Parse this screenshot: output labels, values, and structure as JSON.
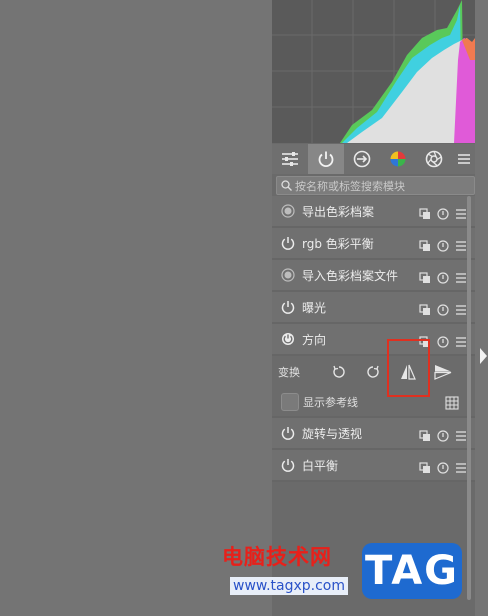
{
  "tabs": [
    {
      "icon": "sliders-icon"
    },
    {
      "icon": "power-icon",
      "active": true
    },
    {
      "icon": "signal-arrow-icon"
    },
    {
      "icon": "color-circle-icon"
    },
    {
      "icon": "aperture-icon"
    },
    {
      "icon": "menu-icon"
    }
  ],
  "search": {
    "placeholder": "按名称或标签搜索模块"
  },
  "modules": [
    {
      "name": "导出色彩档案",
      "power_style": "radio"
    },
    {
      "name": "rgb 色彩平衡",
      "power_style": "power"
    },
    {
      "name": "导入色彩档案文件",
      "power_style": "radio"
    },
    {
      "name": "曝光",
      "power_style": "power"
    },
    {
      "name": "方向",
      "power_style": "power"
    }
  ],
  "orientation": {
    "transform_label": "变换",
    "show_guides_label": "显示参考线"
  },
  "modules_after": [
    {
      "name": "旋转与透视"
    },
    {
      "name": "白平衡"
    }
  ],
  "watermark": {
    "site_name": "电脑技术网",
    "url": "www.tagxp.com",
    "badge": "TAG"
  },
  "colors": {
    "highlight": "#e03020",
    "panel": "#6a6a6a",
    "canvas": "#747474"
  }
}
